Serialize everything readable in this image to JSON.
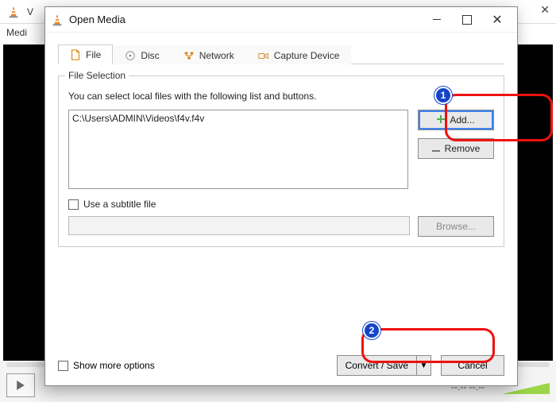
{
  "background": {
    "title_hint": "V",
    "menu": "Medi",
    "time_sep": "--:--    --:--"
  },
  "dialog": {
    "title": "Open Media",
    "tabs": {
      "file": {
        "label": "File"
      },
      "disc": {
        "label": "Disc"
      },
      "network": {
        "label": "Network"
      },
      "capture": {
        "label": "Capture Device"
      }
    },
    "file_selection": {
      "group_title": "File Selection",
      "intro": "You can select local files with the following list and buttons.",
      "files": [
        "C:\\Users\\ADMIN\\Videos\\f4v.f4v"
      ],
      "add_label": "Add...",
      "remove_label": "Remove"
    },
    "subtitle": {
      "checkbox_label": "Use a subtitle file",
      "browse_label": "Browse..."
    },
    "footer": {
      "show_more": "Show more options",
      "convert_label": "Convert / Save",
      "cancel_label": "Cancel"
    }
  },
  "annotations": {
    "badge1": "1",
    "badge2": "2"
  }
}
